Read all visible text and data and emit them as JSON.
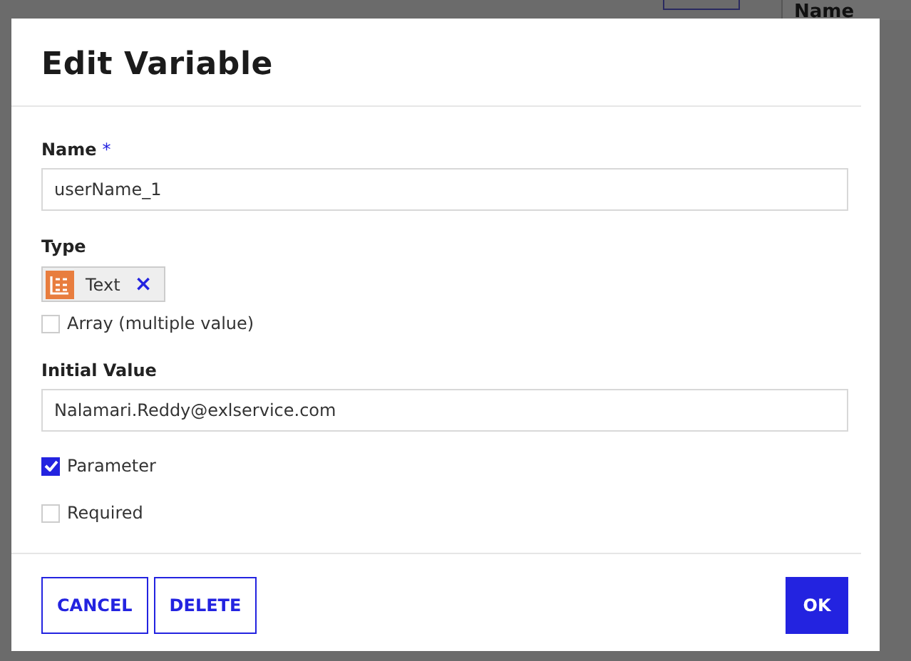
{
  "background": {
    "column_header": "Name"
  },
  "dialog": {
    "title": "Edit Variable",
    "name_field": {
      "label": "Name",
      "required_mark": "*",
      "value": "userName_1"
    },
    "type": {
      "label": "Type",
      "chip": {
        "label": "Text",
        "remove": "×"
      }
    },
    "array": {
      "label": "Array (multiple value)",
      "checked": false
    },
    "initial_value": {
      "label": "Initial Value",
      "value": "Nalamari.Reddy@exlservice.com"
    },
    "options": [
      {
        "label": "Parameter",
        "checked": true
      },
      {
        "label": "Required",
        "checked": false
      }
    ],
    "buttons": [
      {
        "label": "CANCEL",
        "kind": "outline"
      },
      {
        "label": "DELETE",
        "kind": "outline"
      },
      {
        "label": "OK",
        "kind": "primary"
      }
    ]
  }
}
